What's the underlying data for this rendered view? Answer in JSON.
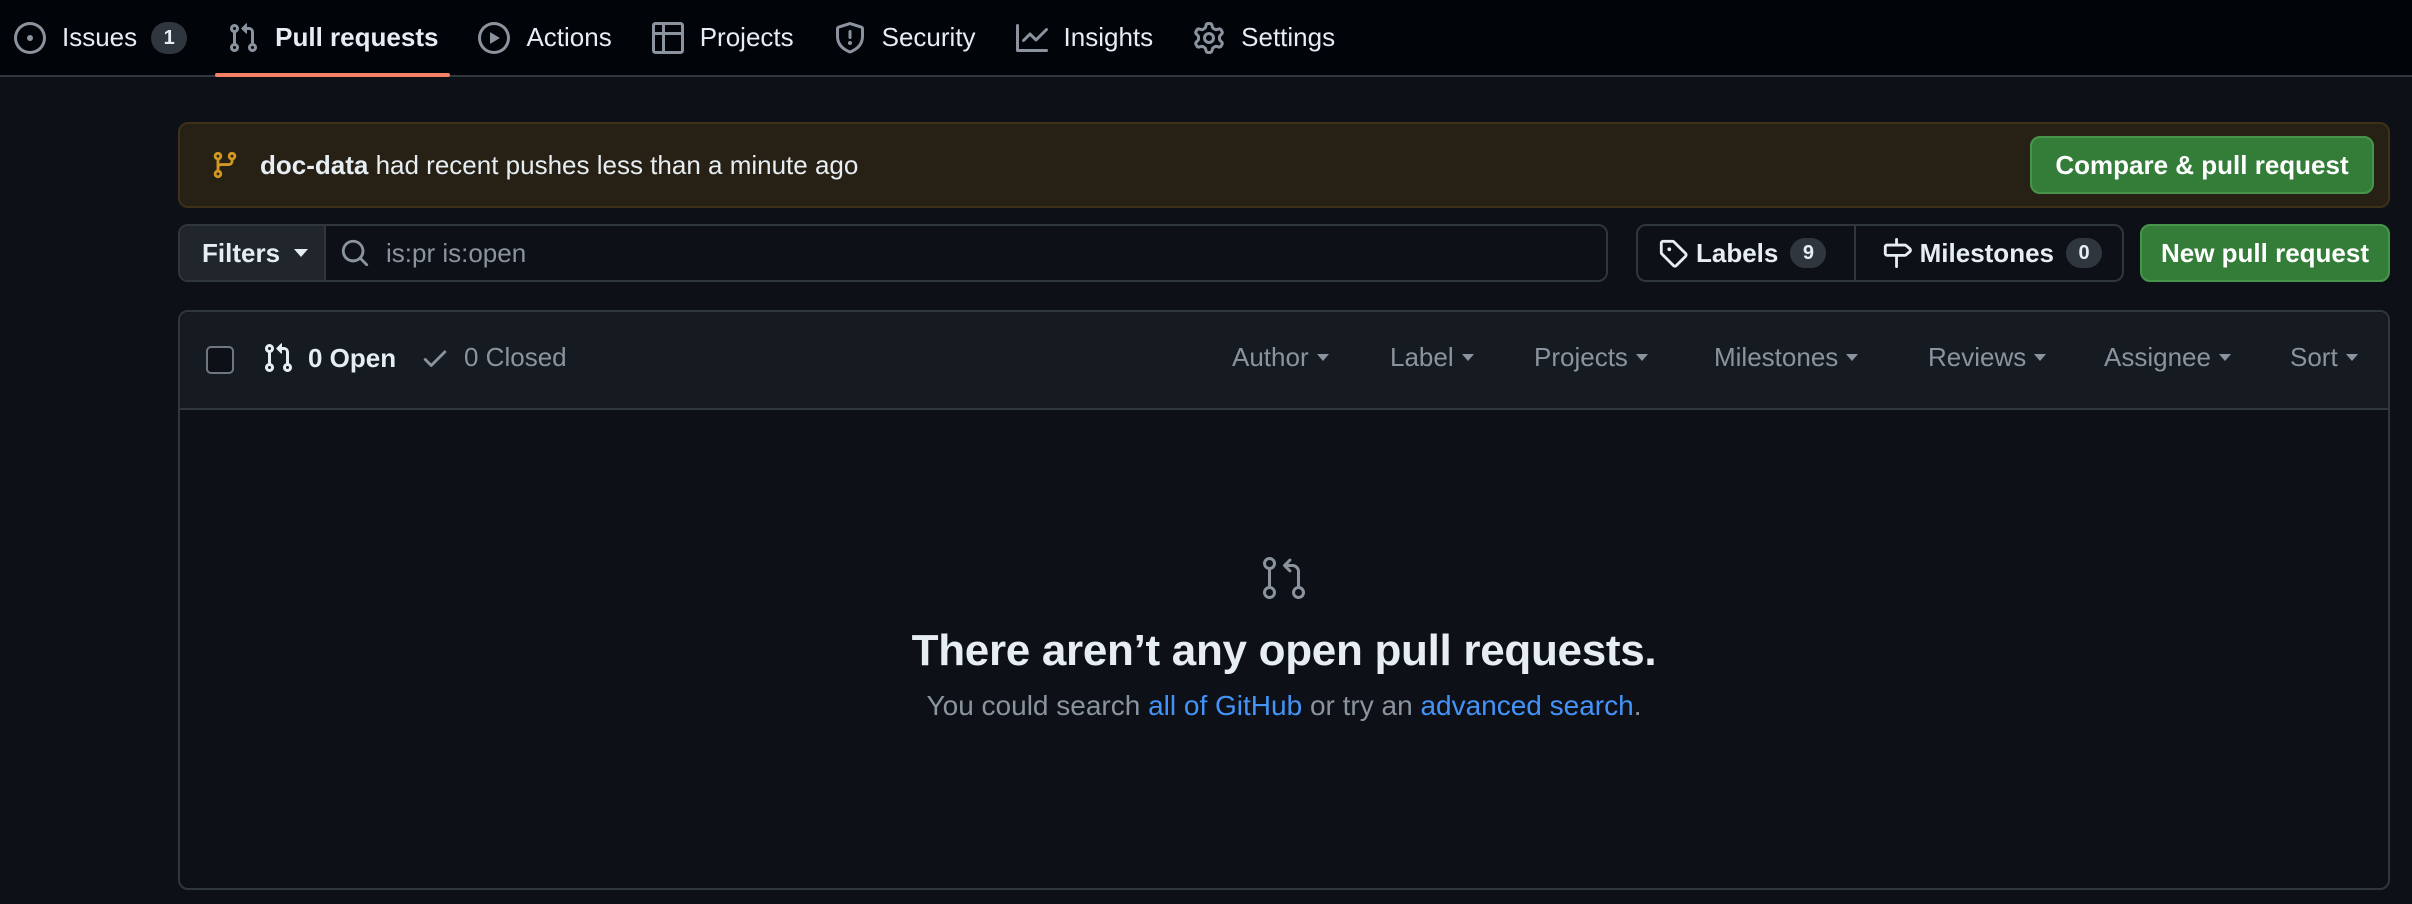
{
  "nav": {
    "tabs": [
      {
        "label": "Issues",
        "icon": "issue-opened-icon",
        "count": "1"
      },
      {
        "label": "Pull requests",
        "icon": "git-pull-request-icon",
        "active": true
      },
      {
        "label": "Actions",
        "icon": "play-icon"
      },
      {
        "label": "Projects",
        "icon": "table-icon"
      },
      {
        "label": "Security",
        "icon": "shield-icon"
      },
      {
        "label": "Insights",
        "icon": "graph-icon"
      },
      {
        "label": "Settings",
        "icon": "gear-icon"
      }
    ]
  },
  "banner": {
    "branch": "doc-data",
    "message": " had recent pushes less than a minute ago",
    "button_label": "Compare & pull request"
  },
  "filters": {
    "button_label": "Filters",
    "search_value": "is:pr is:open"
  },
  "labels_group": {
    "labels_label": "Labels",
    "labels_count": "9",
    "milestones_label": "Milestones",
    "milestones_count": "0"
  },
  "new_pr_label": "New pull request",
  "list_header": {
    "open_label": "0 Open",
    "closed_label": "0 Closed",
    "dropdowns": [
      "Author",
      "Label",
      "Projects",
      "Milestones",
      "Reviews",
      "Assignee",
      "Sort"
    ]
  },
  "empty_state": {
    "title": "There aren’t any open pull requests.",
    "sub_prefix": "You could search ",
    "link1": "all of GitHub",
    "sub_middle": " or try an ",
    "link2": "advanced search",
    "sub_suffix": "."
  },
  "colors": {
    "background": "#0d1117",
    "accent_green": "#347d39",
    "active_tab_underline": "#f78166",
    "link": "#4493f8",
    "banner_icon": "#d29922"
  }
}
